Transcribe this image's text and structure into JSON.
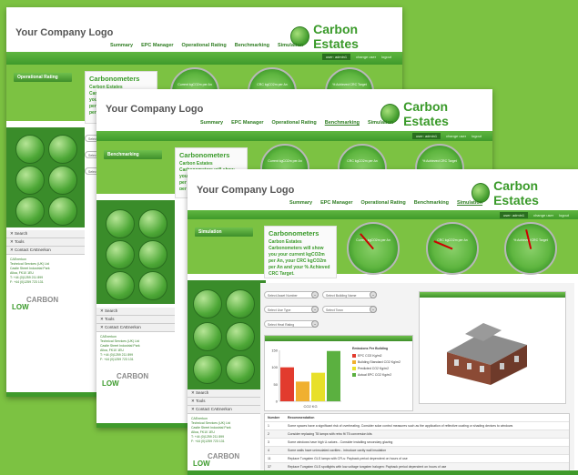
{
  "header": {
    "logo": "Your Company Logo",
    "brand": "Carbon Estates",
    "nav": [
      "Summary",
      "EPC Manager",
      "Operational Rating",
      "Benchmarking",
      "Simulation"
    ]
  },
  "userbar": {
    "label": "user:",
    "user": "admin1",
    "change_user": "change user",
    "logout": "logout"
  },
  "windows": [
    {
      "active_section": "Operational Rating"
    },
    {
      "active_section": "Benchmarking"
    },
    {
      "active_section": "Simulation"
    }
  ],
  "carbonometers": {
    "title": "Carbonometers",
    "description": "Carbon Estates Carbonometers will show you your current kgCO2m per An, your CRC kgCO2m per An and your % Achieved CRC Target.",
    "gauges": [
      {
        "label": "Current kgCO2m per An",
        "level": 0.35
      },
      {
        "label": "CRC kgCO2m per An",
        "level": 0.25
      },
      {
        "label": "% Achieved CRC Target",
        "level": 0.45
      }
    ]
  },
  "selects": [
    "Select Asset Number",
    "Select Building Name",
    "Select Use Type",
    "Select Town",
    "Select Heat Rating"
  ],
  "side_links": [
    "Search",
    "Tools",
    "Contact CAEnerkon"
  ],
  "contact": [
    "CAEnerkon",
    "Technical Services (UK) Ltd",
    "Castle Street Industrial Park",
    "Alloa, FK10 1EU",
    "T: +44 (0)1259 211 899",
    "F: +44 (0)1259 723 131"
  ],
  "carbon_logo": {
    "line1": "CARBON",
    "line2": "LOW",
    "line3": "ENERGY CONSUMPTION"
  },
  "chart_data": {
    "type": "bar",
    "title": "Emissions Per Building",
    "categories": [
      "EPC CO2 Kg/m2",
      "Building Standard CO2 Kg/m2",
      "Predicted CO2 Kg/m2",
      "Actual EPC CO2 Kg/m2"
    ],
    "values": [
      100,
      58,
      84,
      148
    ],
    "colors": [
      "#e23b2e",
      "#f0b030",
      "#e8e02a",
      "#5bb040"
    ],
    "ylim": [
      0,
      150
    ],
    "yticks": [
      0,
      50,
      100,
      150
    ],
    "xlabel": "CO2 KG"
  },
  "recommendations": {
    "headers": [
      "Number",
      "Recommendation"
    ],
    "rows": [
      [
        "1",
        "Some spaces have a significant risk of overheating. Consider solar control measures such as the application of reflective coating or shading devices to windows"
      ],
      [
        "2",
        "Consider replacing T8 lamps with retro fit T5 conversion kits"
      ],
      [
        "3",
        "Some windows have high U-values - Consider installing secondary glazing"
      ],
      [
        "4",
        "Some walls have uninsulated cavities - introduce cavity wall insulation"
      ],
      [
        "11",
        "Replace Tungsten GLS lamps with CFLs: Payback period dependent on hours of use"
      ],
      [
        "37",
        "Replace Tungsten GLS spotlights with low-voltage tungsten halogen: Payback period dependent on hours of use"
      ]
    ]
  }
}
